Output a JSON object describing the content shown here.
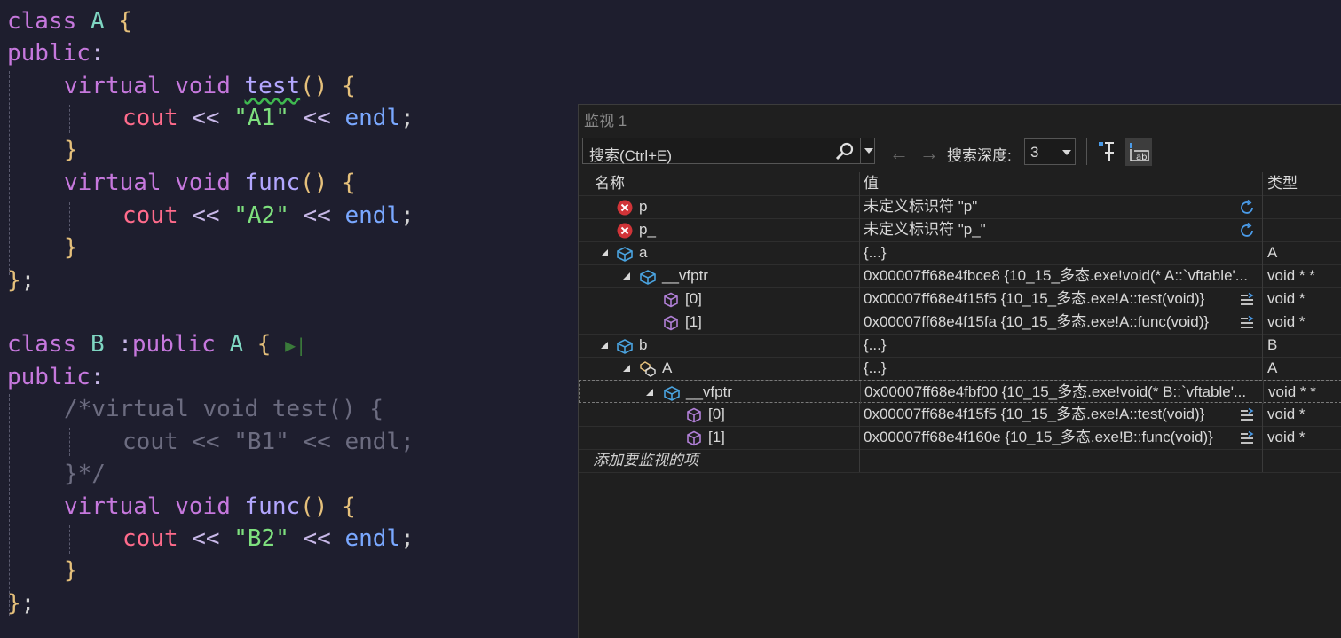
{
  "editor": {
    "code": {
      "l1": {
        "kw": "class",
        "name": "A",
        "brace": "{"
      },
      "l2": {
        "kw": "public",
        "colon": ":"
      },
      "l3": {
        "kw1": "virtual",
        "kw2": "void",
        "fn": "test",
        "paren": "()",
        "brace": "{"
      },
      "l4": {
        "cout": "cout",
        "op1": "<<",
        "str": "\"A1\"",
        "op2": "<<",
        "endl": "endl",
        "semi": ";"
      },
      "l5": {
        "brace": "}"
      },
      "l6": {
        "kw1": "virtual",
        "kw2": "void",
        "fn": "func",
        "paren": "()",
        "brace": "{"
      },
      "l7": {
        "cout": "cout",
        "op1": "<<",
        "str": "\"A2\"",
        "op2": "<<",
        "endl": "endl",
        "semi": ";"
      },
      "l8": {
        "brace": "}"
      },
      "l9": {
        "brace": "}",
        "semi": ";"
      },
      "l10": {
        "kw": "class",
        "name": "B",
        "colon": ":",
        "kw2": "public",
        "base": "A",
        "brace": "{"
      },
      "l11": {
        "kw": "public",
        "colon": ":"
      },
      "l12": {
        "comment": "/*virtual void test() {"
      },
      "l13": {
        "comment": "cout << \"B1\" << endl;"
      },
      "l14": {
        "comment": "}*/"
      },
      "l15": {
        "kw1": "virtual",
        "kw2": "void",
        "fn": "func",
        "paren": "()",
        "brace": "{"
      },
      "l16": {
        "cout": "cout",
        "op1": "<<",
        "str": "\"B2\"",
        "op2": "<<",
        "endl": "endl",
        "semi": ";"
      },
      "l17": {
        "brace": "}"
      },
      "l18": {
        "brace": "}",
        "semi": ";"
      }
    }
  },
  "watch": {
    "title": "监视 1",
    "search_placeholder": "搜索(Ctrl+E)",
    "depth_label": "搜索深度:",
    "depth_value": "3",
    "columns": {
      "name": "名称",
      "value": "值",
      "type": "类型"
    },
    "rows": [
      {
        "name": "p",
        "value": "未定义标识符 \"p\"",
        "type": ""
      },
      {
        "name": "p_",
        "value": "未定义标识符 \"p_\"",
        "type": ""
      },
      {
        "name": "a",
        "value": "{...}",
        "type": "A"
      },
      {
        "name": "__vfptr",
        "value": "0x00007ff68e4fbce8 {10_15_多态.exe!void(* A::`vftable'...",
        "type": "void * *"
      },
      {
        "name": "[0]",
        "value": "0x00007ff68e4f15f5 {10_15_多态.exe!A::test(void)}",
        "type": "void *"
      },
      {
        "name": "[1]",
        "value": "0x00007ff68e4f15fa {10_15_多态.exe!A::func(void)}",
        "type": "void *"
      },
      {
        "name": "b",
        "value": "{...}",
        "type": "B"
      },
      {
        "name": "A",
        "value": "{...}",
        "type": "A"
      },
      {
        "name": "__vfptr",
        "value": "0x00007ff68e4fbf00 {10_15_多态.exe!void(* B::`vftable'...",
        "type": "void * *"
      },
      {
        "name": "[0]",
        "value": "0x00007ff68e4f15f5 {10_15_多态.exe!A::test(void)}",
        "type": "void *"
      },
      {
        "name": "[1]",
        "value": "0x00007ff68e4f160e {10_15_多态.exe!B::func(void)}",
        "type": "void *"
      }
    ],
    "add_item": "添加要监视的项"
  },
  "colors": {
    "error": "#d13438",
    "object": "#4aa3df",
    "member": "#b180d7",
    "accent": "#4a9be8"
  },
  "icons": [
    "error-icon",
    "object-icon",
    "member-icon",
    "base-class-icon",
    "refresh-icon",
    "view-icon",
    "search-icon",
    "pin-icon",
    "hex-icon"
  ]
}
